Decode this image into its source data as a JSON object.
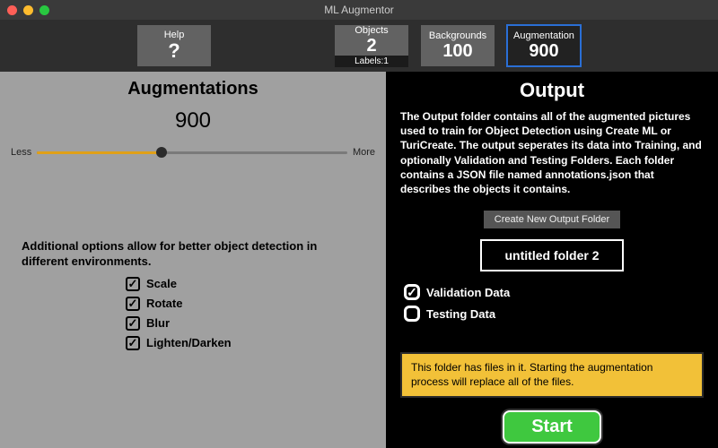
{
  "window": {
    "title": "ML Augmentor"
  },
  "topbar": {
    "help": {
      "label": "Help",
      "value": "?"
    },
    "objects": {
      "label": "Objects",
      "value": "2",
      "sub": "Labels:1"
    },
    "backgrounds": {
      "label": "Backgrounds",
      "value": "100"
    },
    "augmentation": {
      "label": "Augmentation",
      "value": "900"
    }
  },
  "left": {
    "heading": "Augmentations",
    "value": "900",
    "slider": {
      "min_label": "Less",
      "max_label": "More"
    },
    "options_desc": "Additional options allow for better object detection in different environments.",
    "options": [
      {
        "label": "Scale",
        "checked": true
      },
      {
        "label": "Rotate",
        "checked": true
      },
      {
        "label": "Blur",
        "checked": true
      },
      {
        "label": "Lighten/Darken",
        "checked": true
      }
    ]
  },
  "right": {
    "heading": "Output",
    "desc": "The Output folder contains all of the augmented pictures used to train for Object Detection using Create ML or TuriCreate. The output seperates its data into Training, and optionally Validation and Testing Folders. Each folder contains a JSON file named annotations.json that describes the objects it contains.",
    "create_btn": "Create New Output Folder",
    "folder_name": "untitled folder 2",
    "options": [
      {
        "label": "Validation Data",
        "checked": true
      },
      {
        "label": "Testing Data",
        "checked": false
      }
    ],
    "warning": "This folder has files in it. Starting the augmentation process will replace all of the files.",
    "start_btn": "Start"
  }
}
